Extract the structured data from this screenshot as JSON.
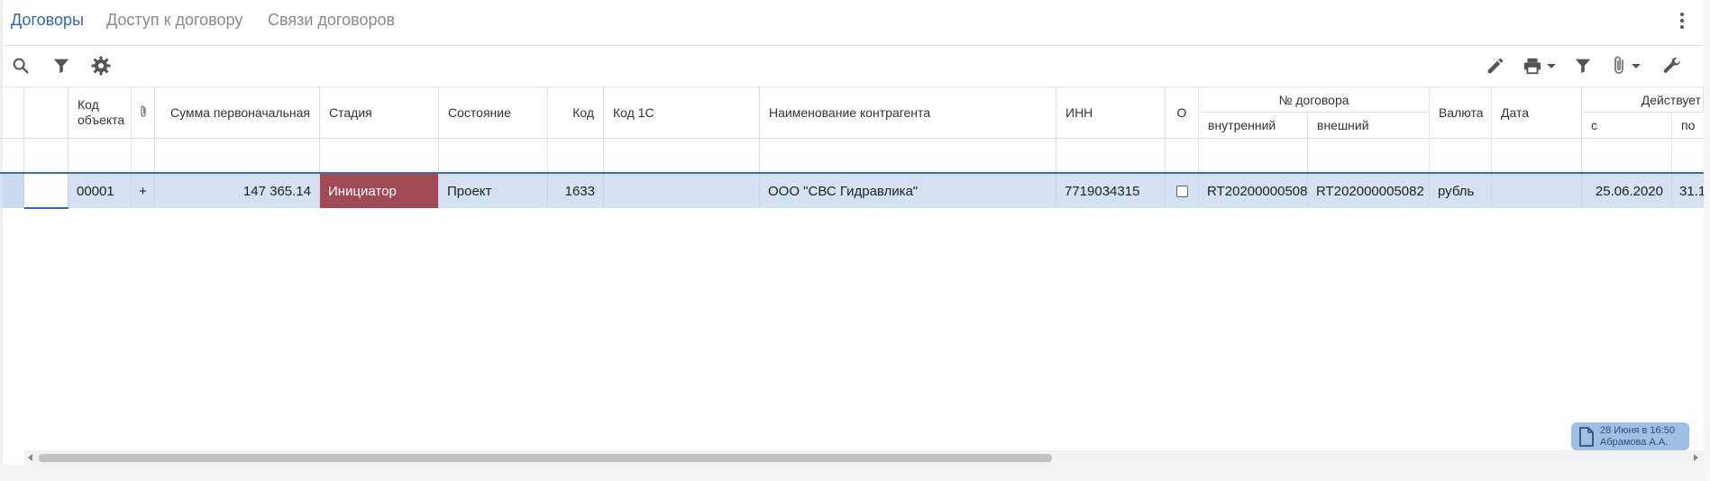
{
  "tabs": [
    {
      "label": "Договоры",
      "active": true
    },
    {
      "label": "Доступ к договору",
      "active": false
    },
    {
      "label": "Связи договоров",
      "active": false
    }
  ],
  "toolbar": {
    "left_icons": [
      "search-icon",
      "filter-icon",
      "gear-icon"
    ],
    "right_icons": [
      "pencil-icon",
      "printer-icon",
      "filter-icon",
      "paperclip-icon",
      "wrench-icon"
    ]
  },
  "table": {
    "headers": {
      "object_code": "Код объекта",
      "attach": "",
      "sum": "Сумма первоначальная",
      "stage": "Стадия",
      "state": "Состояние",
      "code": "Код",
      "code_1c": "Код 1С",
      "counterparty": "Наименование контрагента",
      "inn": "ИНН",
      "o": "О",
      "contract_no": "№ договора",
      "internal": "внутренний",
      "external": "внешний",
      "currency": "Валюта",
      "date": "Дата",
      "valid": "Действует",
      "valid_from": "с",
      "valid_to": "по"
    },
    "rows": [
      {
        "object_code": "00001",
        "attach": "+",
        "sum": "147 365.14",
        "stage": "Инициатор",
        "state": "Проект",
        "code": "1633",
        "code_1c": "",
        "counterparty": "ООО \"СВС Гидравлика\"",
        "inn": "7719034315",
        "o_checked": false,
        "internal": "RT20200000508",
        "external": "RT202000005082",
        "currency": "рубль",
        "date": "",
        "valid_from": "25.06.2020",
        "valid_to": "31.1"
      }
    ]
  },
  "badge": {
    "line1": "28 Июня в 16:50",
    "line2": "Абрамова А.А."
  },
  "colors": {
    "accent": "#2f67b1",
    "stage_bg": "#a14a56",
    "row_selected": "#d3e1f3",
    "badge_bg": "#9fbfe6"
  }
}
